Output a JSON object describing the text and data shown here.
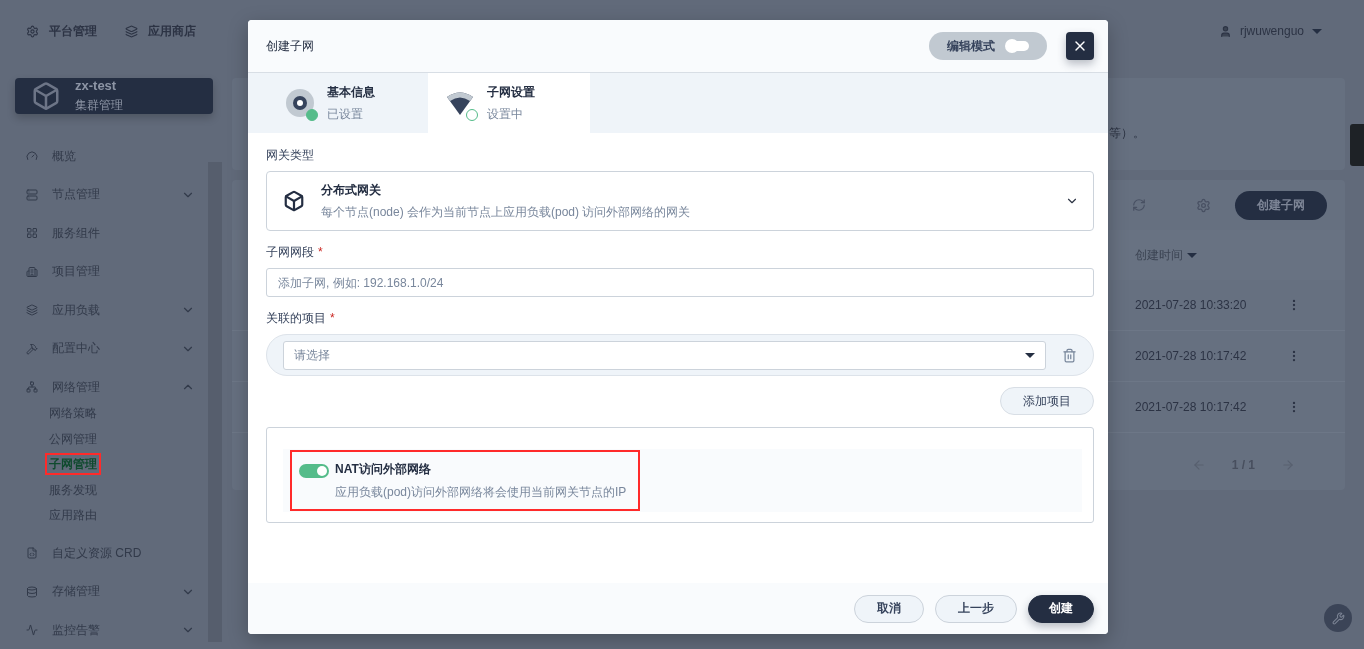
{
  "top_nav": {
    "items": [
      "平台管理",
      "应用商店"
    ],
    "user": "rjwuwenguo"
  },
  "cluster": {
    "name": "zx-test",
    "subtitle": "集群管理"
  },
  "sidebar": {
    "items": [
      {
        "label": "概览"
      },
      {
        "label": "节点管理",
        "expanded": false
      },
      {
        "label": "服务组件"
      },
      {
        "label": "项目管理"
      },
      {
        "label": "应用负载",
        "expanded": false
      },
      {
        "label": "配置中心",
        "expanded": false
      },
      {
        "label": "网络管理",
        "expanded": true,
        "children": [
          {
            "label": "网络策略",
            "selected": false,
            "annotated": false
          },
          {
            "label": "公网管理",
            "selected": false,
            "annotated": false
          },
          {
            "label": "子网管理",
            "selected": true,
            "annotated": true
          },
          {
            "label": "服务发现",
            "selected": false,
            "annotated": false
          },
          {
            "label": "应用路由",
            "selected": false,
            "annotated": false
          }
        ]
      },
      {
        "label": "自定义资源 CRD"
      },
      {
        "label": "存储管理",
        "expanded": false
      },
      {
        "label": "监控告警",
        "expanded": false
      }
    ]
  },
  "content": {
    "notice": "等）。",
    "create_button": "创建子网",
    "table": {
      "columns": [
        "创建时间"
      ],
      "rows": [
        {
          "created": "2021-07-28 10:33:20"
        },
        {
          "created": "2021-07-28 10:17:42"
        },
        {
          "created": "2021-07-28 10:17:42"
        }
      ]
    },
    "pagination": "1 / 1"
  },
  "dialog": {
    "title": "创建子网",
    "edit_mode": {
      "label": "编辑模式",
      "on": false
    },
    "steps": [
      {
        "title": "基本信息",
        "status": "已设置",
        "done": true,
        "selected": false
      },
      {
        "title": "子网设置",
        "status": "设置中",
        "done": false,
        "selected": true
      }
    ],
    "gateway_type": {
      "label": "网关类型",
      "title": "分布式网关",
      "description": "每个节点(node) 会作为当前节点上应用负载(pod) 访问外部网络的网关"
    },
    "subnet": {
      "label": "子网网段",
      "required_mark": "*",
      "placeholder": "添加子网, 例如: 192.168.1.0/24"
    },
    "projects": {
      "label": "关联的项目",
      "required_mark": "*",
      "placeholder": "请选择",
      "add_button": "添加项目"
    },
    "nat": {
      "title": "NAT访问外部网络",
      "description": "应用负载(pod)访问外部网络将会使用当前网关节点的IP",
      "on": true,
      "annotated": true
    },
    "buttons": [
      {
        "label": "取消",
        "kind": "secondary"
      },
      {
        "label": "上一步",
        "kind": "secondary"
      },
      {
        "label": "创建",
        "kind": "primary"
      }
    ]
  }
}
